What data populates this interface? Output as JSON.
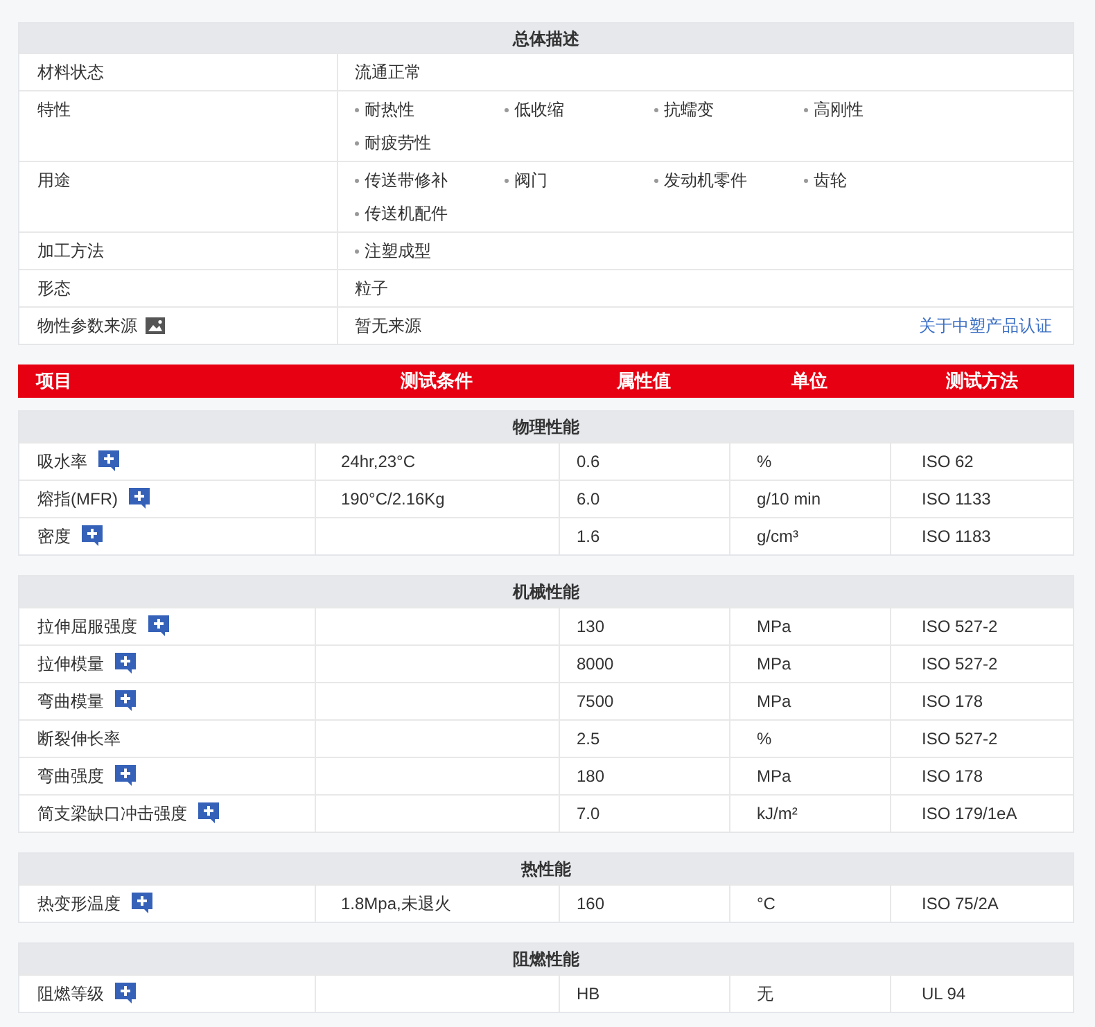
{
  "summary": {
    "title": "总体描述",
    "rows": [
      {
        "kind": "text",
        "label": "材料状态",
        "value": "流通正常"
      },
      {
        "kind": "tags",
        "label": "特性",
        "tags": [
          "耐热性",
          "低收缩",
          "抗蠕变",
          "高刚性",
          "耐疲劳性"
        ]
      },
      {
        "kind": "tags",
        "label": "用途",
        "tags": [
          "传送带修补",
          "阀门",
          "发动机零件",
          "齿轮",
          "传送机配件"
        ]
      },
      {
        "kind": "tags",
        "label": "加工方法",
        "tags": [
          "注塑成型"
        ]
      },
      {
        "kind": "text",
        "label": "形态",
        "value": "粒子"
      },
      {
        "kind": "source",
        "label": "物性参数来源",
        "value": "暂无来源",
        "link": "关于中塑产品认证"
      }
    ]
  },
  "columns": [
    "项目",
    "测试条件",
    "属性值",
    "单位",
    "测试方法"
  ],
  "sections": [
    {
      "title": "物理性能",
      "rows": [
        {
          "item": "吸水率",
          "info": true,
          "condition": "24hr,23°C",
          "value": "0.6",
          "unit": "%",
          "method": "ISO 62"
        },
        {
          "item": "熔指(MFR)",
          "info": true,
          "condition": "190°C/2.16Kg",
          "value": "6.0",
          "unit": "g/10 min",
          "method": "ISO 1133"
        },
        {
          "item": "密度",
          "info": true,
          "condition": "",
          "value": "1.6",
          "unit": "g/cm³",
          "method": "ISO 1183"
        }
      ]
    },
    {
      "title": "机械性能",
      "rows": [
        {
          "item": "拉伸屈服强度",
          "info": true,
          "condition": "",
          "value": "130",
          "unit": "MPa",
          "method": "ISO 527-2"
        },
        {
          "item": "拉伸模量",
          "info": true,
          "condition": "",
          "value": "8000",
          "unit": "MPa",
          "method": "ISO 527-2"
        },
        {
          "item": "弯曲模量",
          "info": true,
          "condition": "",
          "value": "7500",
          "unit": "MPa",
          "method": "ISO 178"
        },
        {
          "item": "断裂伸长率",
          "info": false,
          "condition": "",
          "value": "2.5",
          "unit": "%",
          "method": "ISO 527-2"
        },
        {
          "item": "弯曲强度",
          "info": true,
          "condition": "",
          "value": "180",
          "unit": "MPa",
          "method": "ISO 178"
        },
        {
          "item": "简支梁缺口冲击强度",
          "info": true,
          "condition": "",
          "value": "7.0",
          "unit": "kJ/m²",
          "method": "ISO 179/1eA"
        }
      ]
    },
    {
      "title": "热性能",
      "rows": [
        {
          "item": "热变形温度",
          "info": true,
          "condition": "1.8Mpa,未退火",
          "value": "160",
          "unit": "°C",
          "method": "ISO 75/2A"
        }
      ]
    },
    {
      "title": "阻燃性能",
      "rows": [
        {
          "item": "阻燃等级",
          "info": true,
          "condition": "",
          "value": "HB",
          "unit": "无",
          "method": "UL 94"
        }
      ]
    }
  ]
}
